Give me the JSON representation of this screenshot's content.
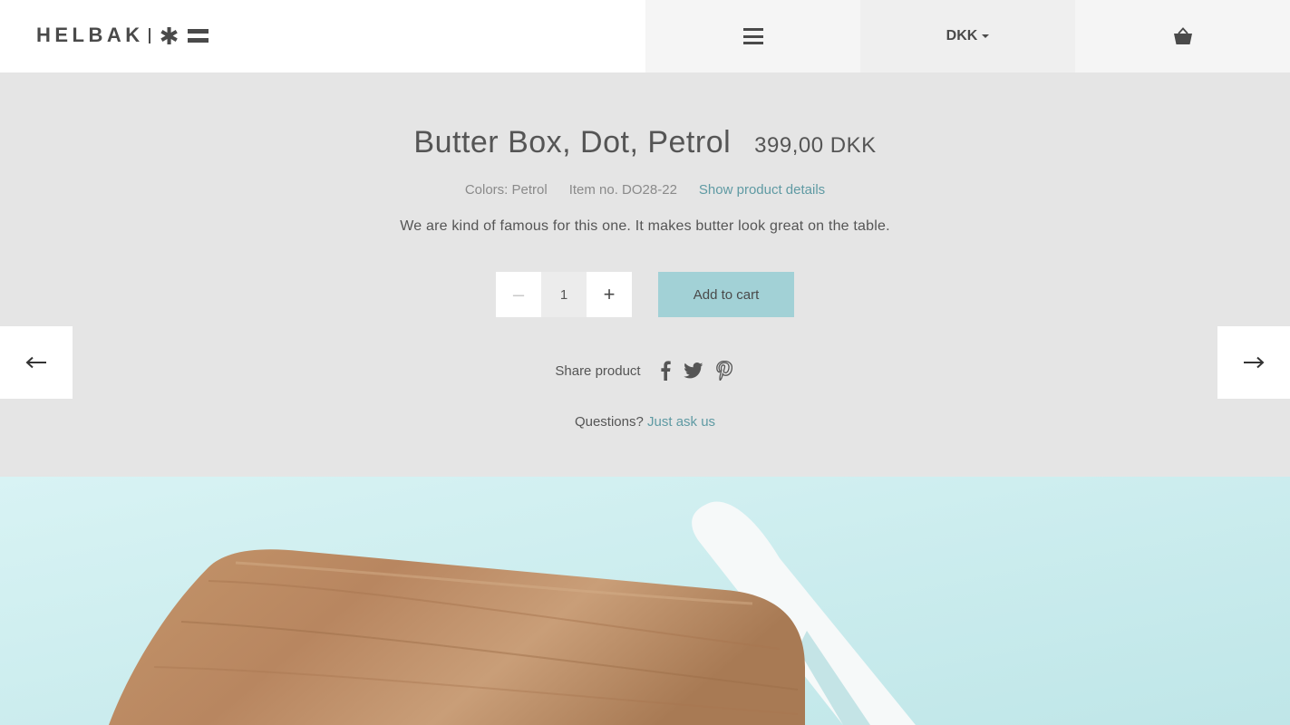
{
  "header": {
    "logo_text": "HELBAK",
    "logo_star": "✱",
    "menu_icon": "hamburger-icon",
    "currency": "DKK",
    "cart_icon": "basket-icon"
  },
  "product": {
    "title": "Butter Box, Dot, Petrol",
    "price": "399,00 DKK",
    "colors": "Colors: Petrol",
    "item_no": "Item no. DO28-22",
    "details_link": "Show product details",
    "description": "We are kind of famous for this one. It makes butter look great on the table.",
    "quantity": "1",
    "minus_label": "–",
    "plus_label": "+",
    "add_to_cart": "Add to cart"
  },
  "share": {
    "label": "Share product",
    "icons": [
      "facebook-icon",
      "twitter-icon",
      "pinterest-icon"
    ]
  },
  "questions": {
    "label": "Questions?",
    "link": "Just ask us"
  },
  "colors": {
    "accent": "#a2d1d6",
    "link": "#5f9aa3",
    "background": "#e5e5e5"
  }
}
